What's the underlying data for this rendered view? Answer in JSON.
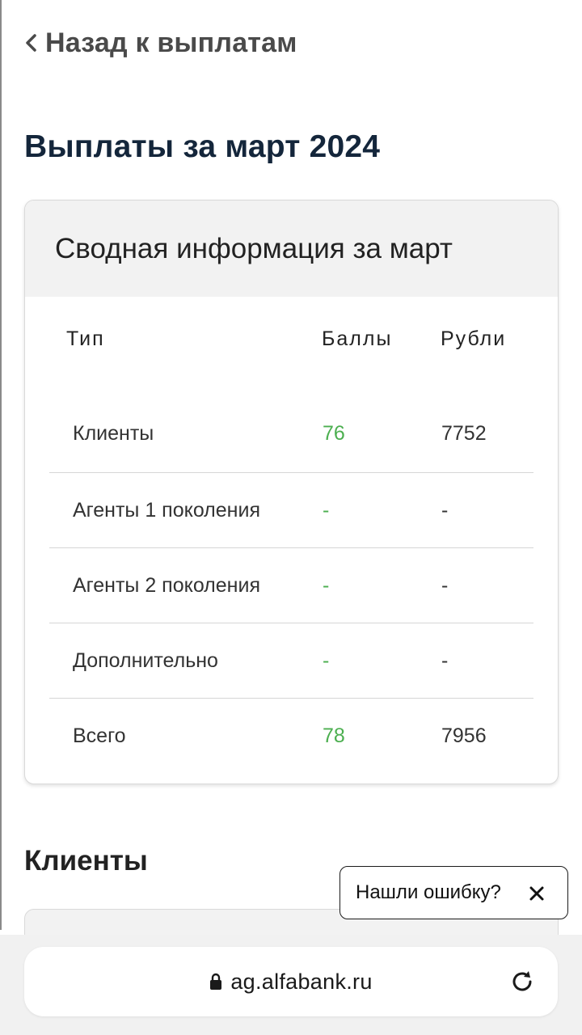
{
  "nav": {
    "back_label": "Назад к выплатам",
    "back_icon": "chevron-left-icon"
  },
  "page": {
    "title": "Выплаты за март 2024"
  },
  "summary": {
    "title": "Сводная информация за март",
    "columns": {
      "type": "Тип",
      "points": "Баллы",
      "rubles": "Рубли"
    },
    "rows": [
      {
        "type": "Клиенты",
        "points": "76",
        "rubles": "7752"
      },
      {
        "type": "Агенты 1 поколения",
        "points": "-",
        "rubles": "-"
      },
      {
        "type": "Агенты 2 поколения",
        "points": "-",
        "rubles": "-"
      },
      {
        "type": "Дополнительно",
        "points": "-",
        "rubles": "-"
      },
      {
        "type": "Всего",
        "points": "78",
        "rubles": "7956"
      }
    ],
    "points_color": "#4caf50"
  },
  "clients_section": {
    "title": "Клиенты"
  },
  "feedback": {
    "label": "Нашли ошибку?",
    "close_icon": "close-icon"
  },
  "browser": {
    "url": "ag.alfabank.ru",
    "lock_icon": "lock-icon",
    "reload_icon": "reload-icon"
  }
}
